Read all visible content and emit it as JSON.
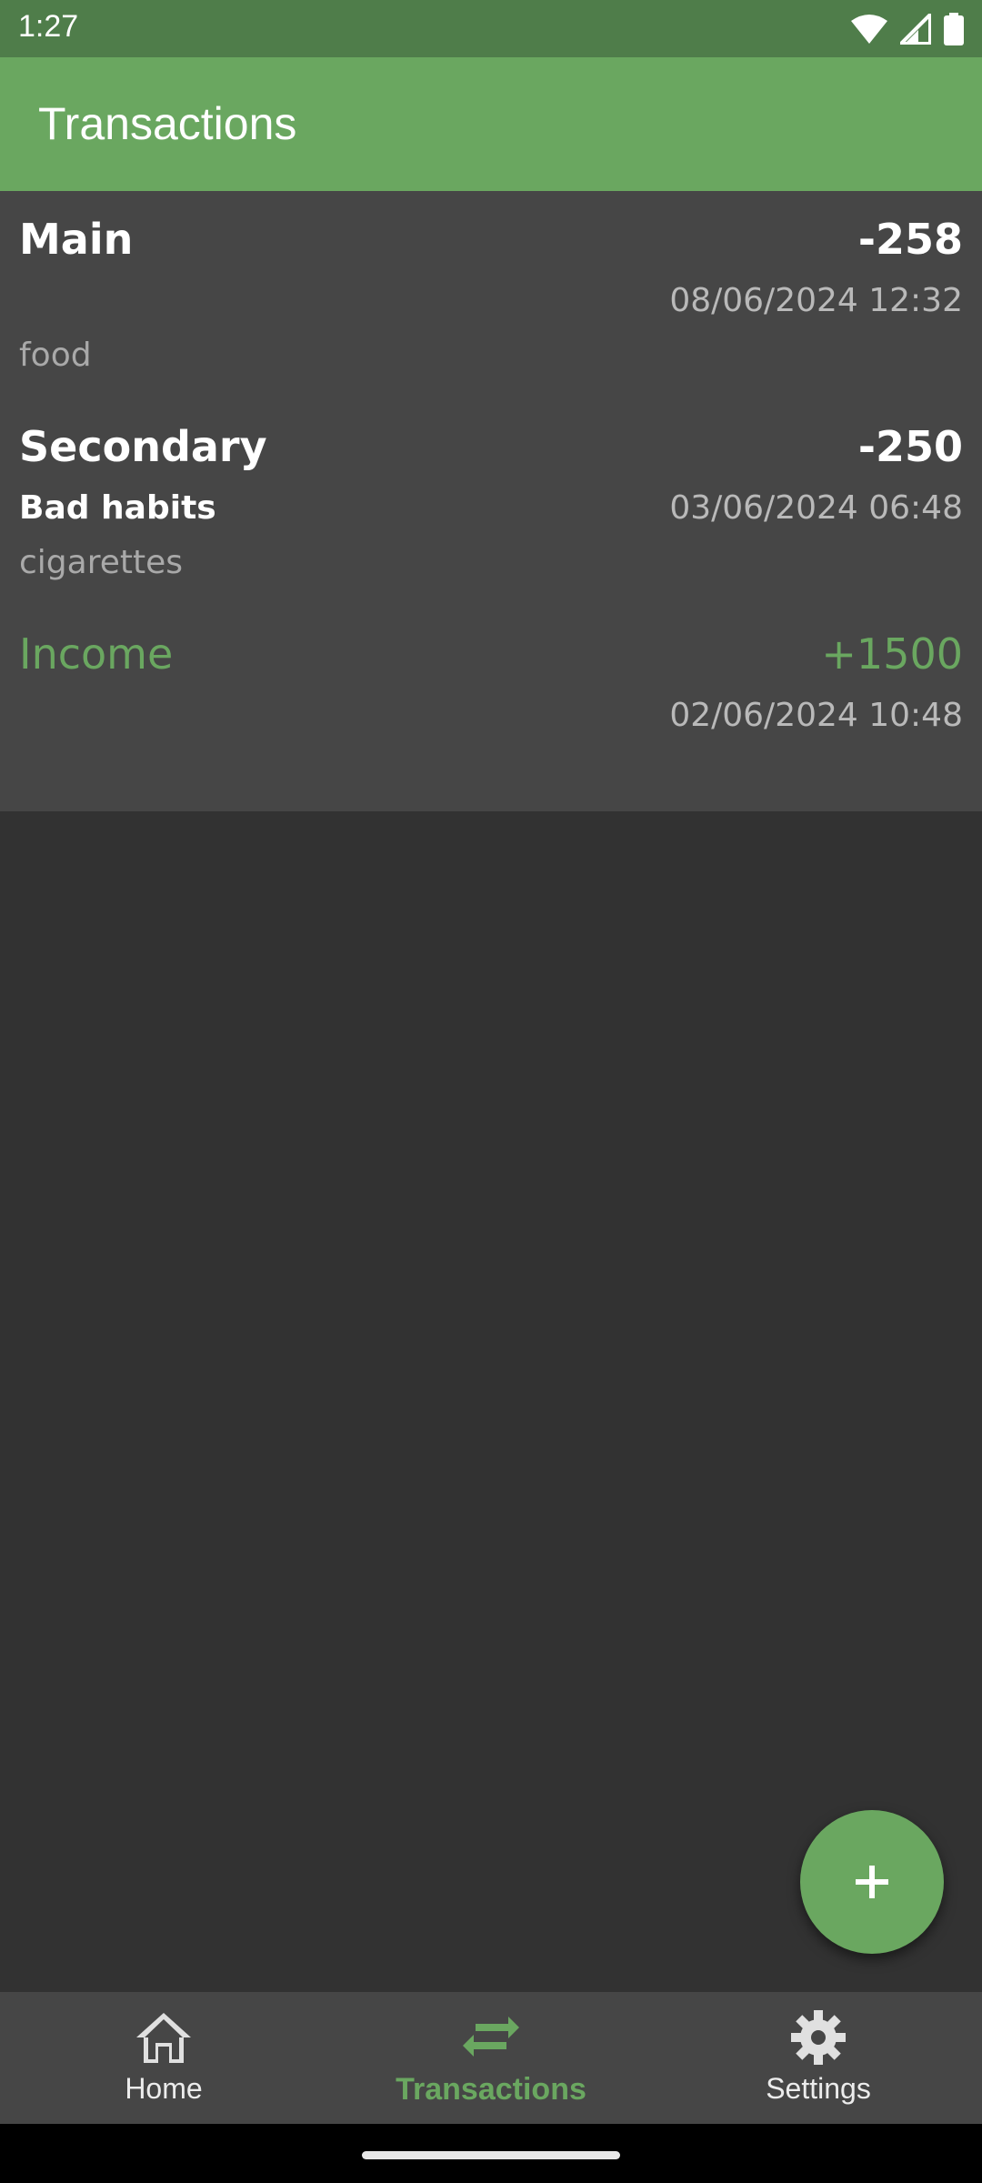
{
  "status_bar": {
    "time": "1:27",
    "icons": [
      "wifi-icon",
      "signal-icon",
      "battery-icon"
    ]
  },
  "app_bar": {
    "title": "Transactions"
  },
  "transactions": [
    {
      "account": "Main",
      "amount": "-258",
      "category": "",
      "date": "08/06/2024 12:32",
      "note": "food",
      "type": "expense"
    },
    {
      "account": "Secondary",
      "amount": "-250",
      "category": "Bad habits",
      "date": "03/06/2024 06:48",
      "note": "cigarettes",
      "type": "expense"
    },
    {
      "account": "Income",
      "amount": "+1500",
      "category": "",
      "date": "02/06/2024 10:48",
      "note": "",
      "type": "income"
    }
  ],
  "fab": {
    "icon": "plus-icon"
  },
  "bottom_nav": {
    "items": [
      {
        "label": "Home",
        "icon": "home-icon",
        "active": false
      },
      {
        "label": "Transactions",
        "icon": "transfer-arrows-icon",
        "active": true
      },
      {
        "label": "Settings",
        "icon": "gear-icon",
        "active": false
      }
    ]
  },
  "colors": {
    "status_bar": "#4f7d4a",
    "accent": "#6aa760",
    "background": "#323232",
    "surface": "#464646"
  }
}
